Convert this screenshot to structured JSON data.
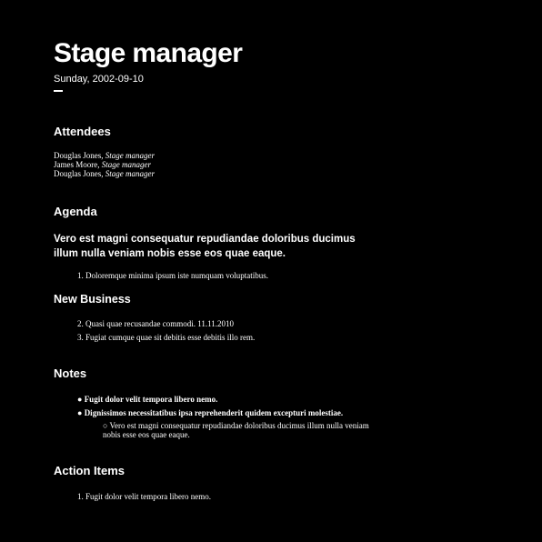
{
  "header": {
    "title": "Stage manager",
    "date": "Sunday, 2002-09-10"
  },
  "attendees": {
    "heading": "Attendees",
    "people": [
      {
        "name": "Douglas Jones, ",
        "role": "Stage manager"
      },
      {
        "name": "James Moore, ",
        "role": "Stage manager"
      },
      {
        "name": "Douglas Jones, ",
        "role": "Stage manager"
      }
    ]
  },
  "agenda": {
    "heading": "Agenda",
    "lead": "Vero est magni consequatur repudiandae doloribus ducimus illum nulla veniam nobis esse eos quae eaque.",
    "items": [
      {
        "num": "1.",
        "text": "Doloremque minima ipsum iste numquam voluptatibus."
      }
    ]
  },
  "new_business": {
    "heading": "New Business",
    "items": [
      {
        "num": "2.",
        "text": "Quasi quae recusandae commodi. 11.11.2010"
      },
      {
        "num": "3.",
        "text": "Fugiat cumque quae sit debitis esse debitis illo rem."
      }
    ]
  },
  "notes": {
    "heading": "Notes",
    "bullets": [
      {
        "marker": "●",
        "text": "Fugit dolor velit tempora libero nemo."
      },
      {
        "marker": "●",
        "text": "Dignissimos necessitatibus ipsa reprehenderit quidem excepturi molestiae."
      }
    ],
    "sub_bullet": {
      "marker": "○",
      "text": "Vero est magni consequatur repudiandae doloribus ducimus illum nulla veniam nobis esse eos quae eaque."
    }
  },
  "action_items": {
    "heading": "Action Items",
    "items": [
      {
        "num": "1.",
        "text": "Fugit dolor velit tempora libero nemo."
      }
    ]
  }
}
